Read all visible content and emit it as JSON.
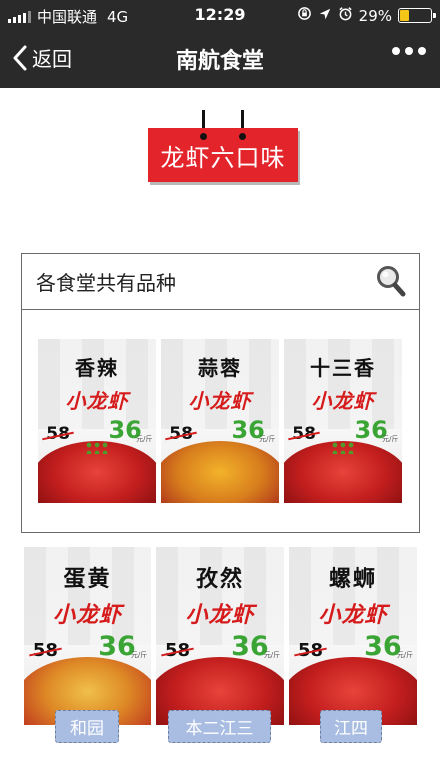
{
  "status_bar": {
    "carrier": "中国联通",
    "network": "4G",
    "time": "12:29",
    "battery": "29%",
    "battery_level": 0.29
  },
  "nav": {
    "back_label": "返回",
    "title": "南航食堂"
  },
  "sign": {
    "text": "龙虾六口味"
  },
  "common": {
    "header": "各食堂共有品种",
    "items": [
      {
        "name": "香辣",
        "sub": "小龙虾",
        "old_price": "58",
        "new_price": "36",
        "unit": "元/斤"
      },
      {
        "name": "蒜蓉",
        "sub": "小龙虾",
        "old_price": "58",
        "new_price": "36",
        "unit": "元/斤"
      },
      {
        "name": "十三香",
        "sub": "小龙虾",
        "old_price": "58",
        "new_price": "36",
        "unit": "元/斤"
      }
    ]
  },
  "special": {
    "items": [
      {
        "name": "蛋黄",
        "sub": "小龙虾",
        "old_price": "58",
        "new_price": "36",
        "unit": "元/斤",
        "canteen": "和园"
      },
      {
        "name": "孜然",
        "sub": "小龙虾",
        "old_price": "58",
        "new_price": "36",
        "unit": "元/斤",
        "canteen": "本二江三"
      },
      {
        "name": "螺蛳",
        "sub": "小龙虾",
        "old_price": "58",
        "new_price": "36",
        "unit": "元/斤",
        "canteen": "江四"
      }
    ]
  },
  "colors": {
    "sign_red": "#e3242b",
    "price_green": "#3aa534",
    "tag_blue": "#a9bde2"
  }
}
